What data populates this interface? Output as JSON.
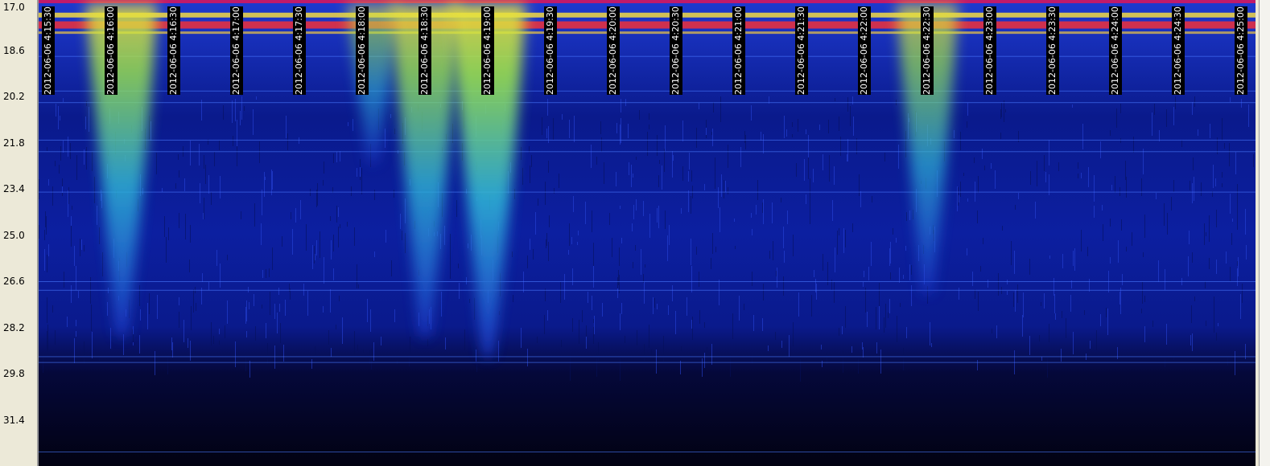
{
  "chart_data": {
    "type": "heatmap",
    "title": "",
    "xlabel": "",
    "ylabel": "",
    "y_ticks": [
      "17.0",
      "18.6",
      "20.2",
      "21.8",
      "23.4",
      "25.0",
      "26.6",
      "28.2",
      "29.8",
      "31.4"
    ],
    "y_range": [
      17.0,
      33.0
    ],
    "x_ticks": [
      "2012-06-06 4:15:30",
      "2012-06-06 4:16:00",
      "2012-06-06 4:16:30",
      "2012-06-06 4:17:00",
      "2012-06-06 4:17:30",
      "2012-06-06 4:18:00",
      "2012-06-06 4:18:30",
      "2012-06-06 4:19:00",
      "2012-06-06 4:19:30",
      "2012-06-06 4:20:00",
      "2012-06-06 4:20:30",
      "2012-06-06 4:21:00",
      "2012-06-06 4:21:30",
      "2012-06-06 4:22:00",
      "2012-06-06 4:22:30",
      "2012-06-06 4:23:00",
      "2012-06-06 4:23:30",
      "2012-06-06 4:24:00",
      "2012-06-06 4:24:30",
      "2012-06-06 4:25:00"
    ],
    "colormap": [
      "#020212",
      "#0a1a8c",
      "#1e3ad0",
      "#2fb8d8",
      "#9ee84a",
      "#f4e23a",
      "#f0303a"
    ],
    "bursts": [
      {
        "time": "4:16:05",
        "y_start": 17.0,
        "y_end": 28.5,
        "intensity": 0.75
      },
      {
        "time": "4:18:05",
        "y_start": 17.0,
        "y_end": 22.5,
        "intensity": 0.35
      },
      {
        "time": "4:18:30",
        "y_start": 17.0,
        "y_end": 28.5,
        "intensity": 0.7
      },
      {
        "time": "4:19:00",
        "y_start": 17.0,
        "y_end": 29.2,
        "intensity": 0.85
      },
      {
        "time": "4:22:30",
        "y_start": 17.0,
        "y_end": 27.0,
        "intensity": 0.55
      }
    ]
  }
}
